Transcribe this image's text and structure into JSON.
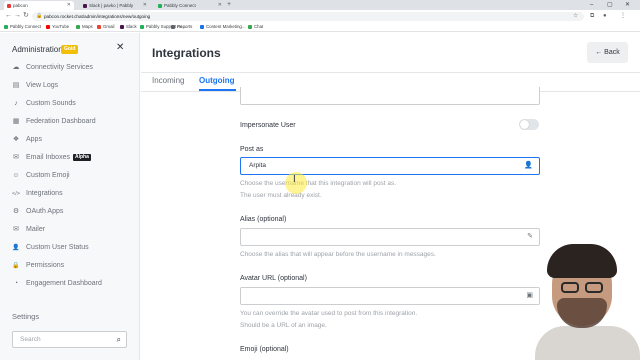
{
  "browser": {
    "tabs": [
      {
        "title": "pabcon",
        "active": true,
        "favicon_color": "#e53935"
      },
      {
        "title": "Slack | pavko | Pabbly",
        "active": false,
        "favicon_color": "#4a154b"
      },
      {
        "title": "Pabbly Connect",
        "active": false,
        "favicon_color": "#20b15a"
      }
    ],
    "new_tab": "+",
    "url": "pabcon.rocket.chat/admin/integrations/new/outgoing",
    "bookmarks": [
      {
        "label": "Pabbly Connect",
        "color": "#20b15a"
      },
      {
        "label": "YouTube",
        "color": "#ff0000"
      },
      {
        "label": "Maps",
        "color": "#34a853"
      },
      {
        "label": "Gmail",
        "color": "#ea4335"
      },
      {
        "label": "Slack",
        "color": "#4a154b"
      },
      {
        "label": "Pabbly Support Fo...",
        "color": "#20b15a"
      },
      {
        "label": "Reports",
        "color": "#5f6368"
      },
      {
        "label": "Content Marketing...",
        "color": "#1a73e8"
      },
      {
        "label": "Chat",
        "color": "#34a853"
      }
    ]
  },
  "sidebar": {
    "title": "Administration",
    "badge": "Gold",
    "close": "✕",
    "items": [
      {
        "label": "Connectivity Services",
        "icon": "☁"
      },
      {
        "label": "View Logs",
        "icon": "▤"
      },
      {
        "label": "Custom Sounds",
        "icon": "♪"
      },
      {
        "label": "Federation Dashboard",
        "icon": "▦"
      },
      {
        "label": "Apps",
        "icon": "❖"
      },
      {
        "label": "Email Inboxes",
        "icon": "✉",
        "badge": "Alpha"
      },
      {
        "label": "Custom Emoji",
        "icon": "☺"
      },
      {
        "label": "Integrations",
        "icon": "</>"
      },
      {
        "label": "OAuth Apps",
        "icon": "⚙"
      },
      {
        "label": "Mailer",
        "icon": "✉"
      },
      {
        "label": "Custom User Status",
        "icon": "👤"
      },
      {
        "label": "Permissions",
        "icon": "🔒"
      },
      {
        "label": "Engagement Dashboard",
        "icon": "◔"
      }
    ],
    "settings_label": "Settings",
    "search_placeholder": "Search"
  },
  "main": {
    "title": "Integrations",
    "back_label": "← Back",
    "tabs": [
      {
        "label": "Incoming",
        "active": false
      },
      {
        "label": "Outgoing",
        "active": true
      }
    ],
    "impersonate_label": "Impersonate User",
    "impersonate_on": false,
    "post_as": {
      "label": "Post as",
      "value": "Arpita",
      "hint1": "Choose the username that this integration will post as.",
      "hint2": "The user must already exist."
    },
    "alias": {
      "label": "Alias (optional)",
      "value": "",
      "hint": "Choose the alias that will appear before the username in messages."
    },
    "avatar": {
      "label": "Avatar URL (optional)",
      "value": "",
      "hint1": "You can override the avatar used to post from this integration.",
      "hint2": "Should be a URL of an image."
    },
    "emoji_label": "Emoji (optional)"
  }
}
